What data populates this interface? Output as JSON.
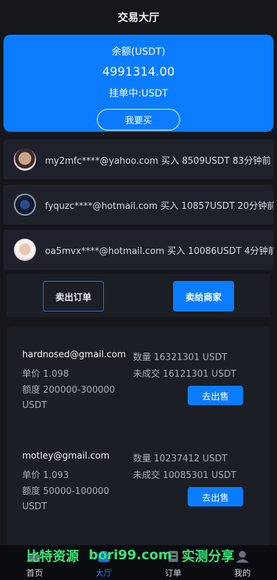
{
  "header": {
    "title": "交易大厅"
  },
  "balance": {
    "label": "余额(USDT)",
    "amount": "4991314.00",
    "pending": "挂单中:USDT",
    "buy_button": "我要买"
  },
  "feed": [
    {
      "avatar": "avatar-pink-cartoon",
      "text": "my2mfc****@yahoo.com 买入 8509USDT 83分钟前"
    },
    {
      "avatar": "avatar-night-figure",
      "text": "fyquzc****@hotmail.com 买入 10857USDT 20分钟前"
    },
    {
      "avatar": "avatar-sunglasses",
      "text": "oa5mvx****@hotmail.com 买入 10086USDT 4分钟前"
    }
  ],
  "tabs": {
    "sell_orders": "卖出订单",
    "sell_to_merchant": "卖给商家"
  },
  "offers": [
    {
      "email": "hardnosed@gmail.com",
      "price": "单价 1.098",
      "limit": "额度 200000-300000 USDT",
      "quantity": "数量 16321301 USDT",
      "unfilled": "未成交 16121301 USDT",
      "action": "去出售"
    },
    {
      "email": "motley@gmail.com",
      "price": "单价 1.093",
      "limit": "额度 50000-100000 USDT",
      "quantity": "数量 10237412 USDT",
      "unfilled": "未成交 10085301 USDT",
      "action": "去出售"
    }
  ],
  "nav": [
    {
      "label": "首页",
      "icon": "home-icon",
      "active": false
    },
    {
      "label": "大厅",
      "icon": "hall-icon",
      "active": true
    },
    {
      "label": "订单",
      "icon": "order-icon",
      "active": false
    },
    {
      "label": "我的",
      "icon": "user-icon",
      "active": false
    }
  ],
  "watermark": {
    "left": "比特资源",
    "mid": "bori99.com",
    "right": "实测分享"
  },
  "colors": {
    "accent": "#0b7cff",
    "background": "#15171c",
    "card": "#1e2129"
  }
}
